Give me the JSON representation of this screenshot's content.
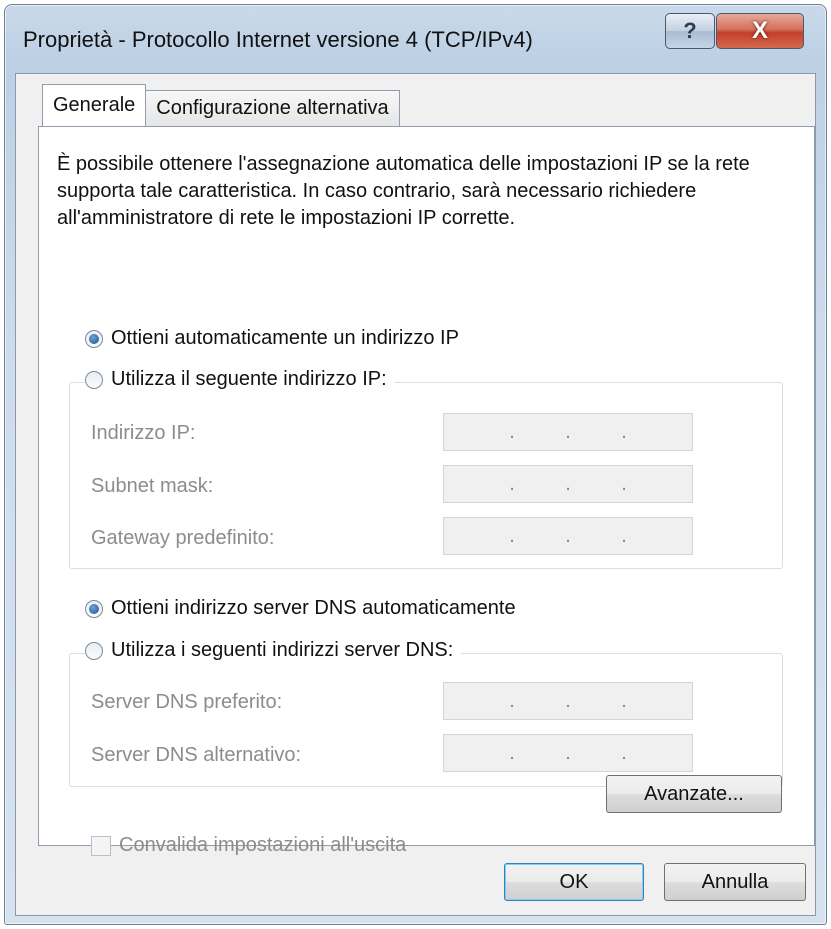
{
  "window": {
    "title": "Proprietà - Protocollo Internet versione 4 (TCP/IPv4)",
    "help_glyph": "?",
    "close_glyph": "X"
  },
  "tabs": [
    {
      "label": "Generale",
      "active": true
    },
    {
      "label": "Configurazione alternativa",
      "active": false
    }
  ],
  "description": "È possibile ottenere l'assegnazione automatica delle impostazioni IP se la rete supporta tale caratteristica. In caso contrario, sarà necessario richiedere all'amministratore di rete le impostazioni IP corrette.",
  "ip": {
    "auto_label": "Ottieni automaticamente un indirizzo IP",
    "auto_selected": true,
    "manual_label": "Utilizza il seguente indirizzo IP:",
    "manual_selected": false,
    "fields": [
      {
        "label": "Indirizzo IP:",
        "value": ". . ."
      },
      {
        "label": "Subnet mask:",
        "value": ". . ."
      },
      {
        "label": "Gateway predefinito:",
        "value": ". . ."
      }
    ]
  },
  "dns": {
    "auto_label": "Ottieni indirizzo server DNS automaticamente",
    "auto_selected": true,
    "manual_label": "Utilizza i seguenti indirizzi server DNS:",
    "manual_selected": false,
    "fields": [
      {
        "label": "Server DNS preferito:",
        "value": ". . ."
      },
      {
        "label": "Server DNS alternativo:",
        "value": ". . ."
      }
    ]
  },
  "validate_label": "Convalida impostazioni all'uscita",
  "validate_checked": false,
  "buttons": {
    "advanced": "Avanzate...",
    "ok": "OK",
    "cancel": "Annulla"
  },
  "colors": {
    "accent": "#1d4f8a",
    "disabled_text": "#8c8c8c"
  }
}
